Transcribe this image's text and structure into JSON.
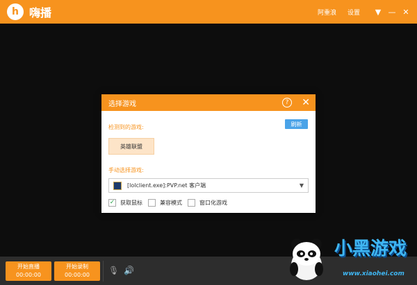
{
  "app": {
    "logo_glyph": "h",
    "name": "嗨播"
  },
  "topbar": {
    "user": "阿重浪",
    "settings": "设置",
    "menu_glyph": "▼",
    "minimize_glyph": "—",
    "close_glyph": "✕"
  },
  "dialog": {
    "title": "选择游戏",
    "help_glyph": "?",
    "close_glyph": "✕",
    "detected_label": "检测到的游戏:",
    "refresh_label": "刷新",
    "detected_game": "英雄联盟",
    "manual_label": "手动选择游戏:",
    "selected_game": "[lolclient.exe]:PVP.net 客户端",
    "select_arrow": "▼",
    "options": [
      {
        "label": "获取鼠标",
        "checked": true,
        "mark": "✓"
      },
      {
        "label": "兼容模式",
        "checked": false,
        "mark": ""
      },
      {
        "label": "窗口化游戏",
        "checked": false,
        "mark": ""
      }
    ]
  },
  "bottom": {
    "live": {
      "label": "开始直播",
      "time": "00:00:00"
    },
    "record": {
      "label": "开始录制",
      "time": "00:00:00"
    },
    "mic_glyph": "🎙",
    "speaker_glyph": "🔊"
  },
  "watermark": {
    "text": "小黑游戏",
    "url": "www.xiaohei.com"
  },
  "colors": {
    "accent": "#f7931e",
    "refresh": "#4aa3e8",
    "watermark": "#3fb6f2"
  }
}
